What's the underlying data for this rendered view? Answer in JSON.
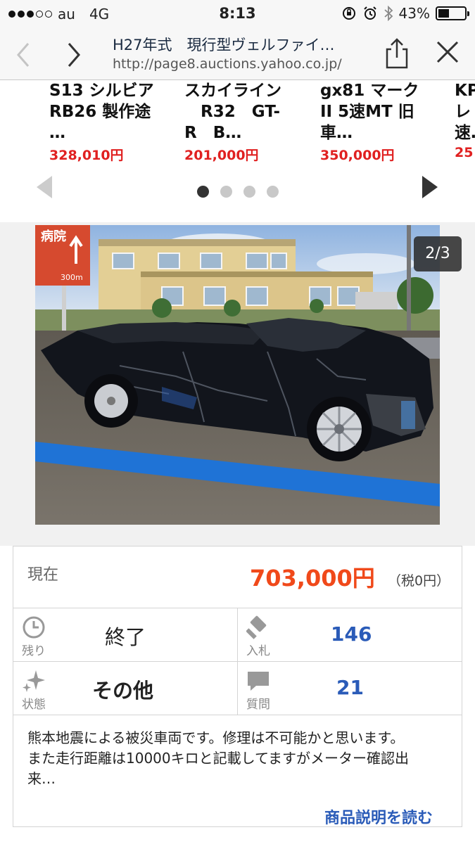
{
  "status_bar": {
    "carrier": "au",
    "network": "4G",
    "time": "8:13",
    "battery_text": "43%",
    "battery_level": 0.43
  },
  "browser": {
    "title": "H27年式　現行型ヴェルファイ…",
    "url": "http://page8.auctions.yahoo.co.jp/"
  },
  "carousel": {
    "items": [
      {
        "title_line1": "S13 シルビア",
        "title_line2": "RB26 製作途",
        "title_line3": "…",
        "price": "328,010円"
      },
      {
        "title_line1": "スカイライン",
        "title_line2": "　R32　GT-",
        "title_line3": "R　B…",
        "price": "201,000円"
      },
      {
        "title_line1": "gx81 マーク",
        "title_line2": "II 5速MT 旧",
        "title_line3": "車…",
        "price": "350,000円"
      },
      {
        "title_line1": "KP",
        "title_line2": "レ",
        "title_line3": "速…",
        "price": "25"
      }
    ],
    "page_count": 4,
    "current_page": 1
  },
  "gallery": {
    "counter": "2/3",
    "sign_text": "病院",
    "sign_subtext": "300m"
  },
  "auction": {
    "current_label": "現在",
    "current_price": "703,000円",
    "tax_note": "（税0円）",
    "remaining_label": "残り",
    "remaining_value": "終了",
    "bids_label": "入札",
    "bids_value": "146",
    "condition_label": "状態",
    "condition_value": "その他",
    "questions_label": "質問",
    "questions_value": "21",
    "description_line1": "熊本地震による被災車両です。修理は不可能かと思います。",
    "description_line2": "また走行距離は10000キロと記載してますがメーター確認出",
    "description_line3": "来…",
    "read_more": "商品説明を読む"
  },
  "colors": {
    "price_red": "#e02020",
    "current_price_orange": "#f0491a",
    "link_blue": "#2a5bb8"
  }
}
